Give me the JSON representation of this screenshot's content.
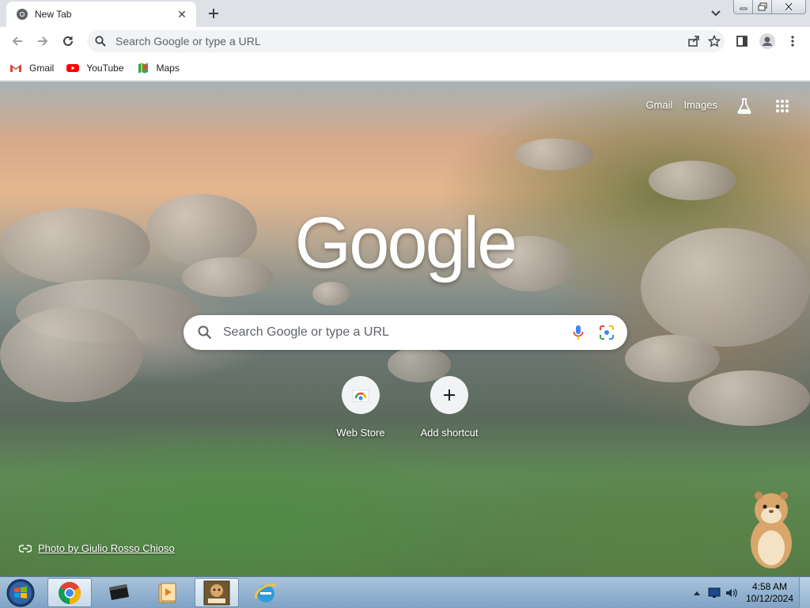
{
  "tab": {
    "title": "New Tab",
    "close_symbol": "✕"
  },
  "toolbar": {
    "omnibox_placeholder": "Search Google or type a URL"
  },
  "bookmarks": [
    {
      "label": "Gmail",
      "icon": "gmail-icon"
    },
    {
      "label": "YouTube",
      "icon": "youtube-icon"
    },
    {
      "label": "Maps",
      "icon": "maps-icon"
    }
  ],
  "ntp": {
    "links": [
      "Gmail",
      "Images"
    ],
    "logo": "Google",
    "search_placeholder": "Search Google or type a URL",
    "shortcuts": [
      {
        "label": "Web Store",
        "icon": "web-store-icon"
      },
      {
        "label": "Add shortcut",
        "icon": "plus-icon"
      }
    ],
    "photo_credit": "Photo by Giulio Rosso Chioso"
  },
  "taskbar": {
    "apps": [
      "chrome-icon",
      "terminal-icon",
      "media-player-icon",
      "game-box-icon",
      "internet-explorer-icon"
    ],
    "time": "4:58 AM",
    "date": "10/12/2024"
  },
  "colors": {
    "accent_blue": "#1a73e8",
    "tab_strip": "#dee1e6",
    "taskbar": "#8fb0cf"
  }
}
